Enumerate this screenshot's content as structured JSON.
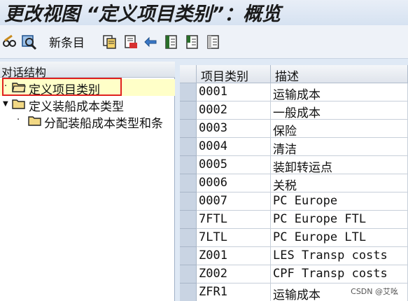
{
  "window": {
    "title": "更改视图 “定义项目类别”：概览"
  },
  "toolbar": {
    "icons": [
      "glasses-edit-icon",
      "display-change-icon",
      "copy-icon",
      "delete-icon",
      "undo-icon",
      "select-all-icon",
      "select-block-icon",
      "deselect-all-icon"
    ],
    "new_entries_label": "新条目"
  },
  "tree": {
    "header": "对话结构",
    "items": [
      {
        "label": "定义项目类别",
        "level": 0,
        "selected": true
      },
      {
        "label": "定义装船成本类型",
        "level": 0,
        "expanded": true
      },
      {
        "label": "分配装船成本类型和条",
        "level": 1
      }
    ]
  },
  "table": {
    "columns": [
      "项目类别",
      "描述"
    ],
    "rows": [
      {
        "code": "0001",
        "desc": "运输成本"
      },
      {
        "code": "0002",
        "desc": "一般成本"
      },
      {
        "code": "0003",
        "desc": "保险"
      },
      {
        "code": "0004",
        "desc": "清洁"
      },
      {
        "code": "0005",
        "desc": "装卸转运点"
      },
      {
        "code": "0006",
        "desc": "关税"
      },
      {
        "code": "0007",
        "desc": "PC Europe"
      },
      {
        "code": "7FTL",
        "desc": "PC Europe FTL"
      },
      {
        "code": "7LTL",
        "desc": "PC Europe LTL"
      },
      {
        "code": "Z001",
        "desc": "LES Transp costs"
      },
      {
        "code": "Z002",
        "desc": "CPF Transp costs"
      },
      {
        "code": "ZFR1",
        "desc": "运输成本"
      }
    ]
  },
  "watermark": "CSDN @艾吆",
  "colors": {
    "selected_row": "#ffffc8",
    "highlight_box": "#e0211f",
    "background": "#dfe9f5"
  }
}
